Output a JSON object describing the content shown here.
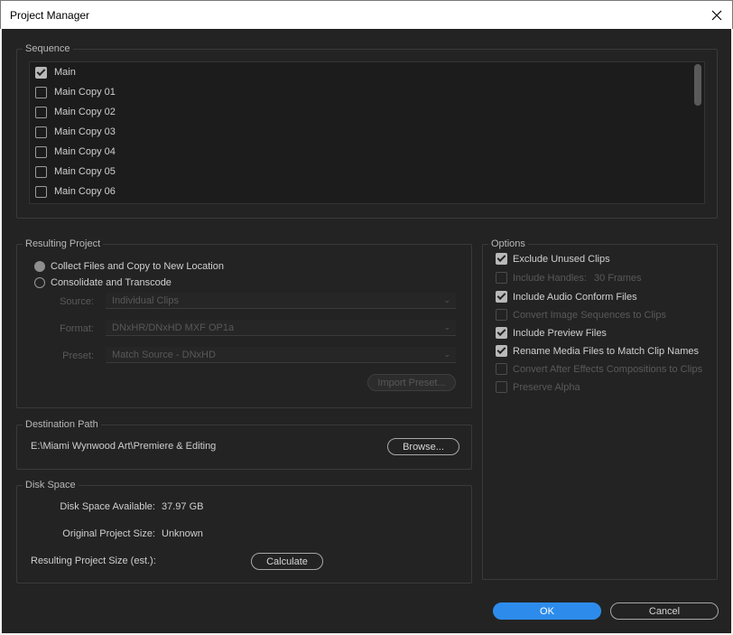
{
  "window": {
    "title": "Project Manager"
  },
  "sequence": {
    "legend": "Sequence",
    "items": [
      {
        "label": "Main",
        "checked": true
      },
      {
        "label": "Main Copy 01",
        "checked": false
      },
      {
        "label": "Main Copy 02",
        "checked": false
      },
      {
        "label": "Main Copy 03",
        "checked": false
      },
      {
        "label": "Main Copy 04",
        "checked": false
      },
      {
        "label": "Main Copy 05",
        "checked": false
      },
      {
        "label": "Main Copy 06",
        "checked": false
      }
    ]
  },
  "resulting_project": {
    "legend": "Resulting Project",
    "options": [
      {
        "label": "Collect Files and Copy to New Location",
        "selected": true
      },
      {
        "label": "Consolidate and Transcode",
        "selected": false
      }
    ],
    "source_label": "Source:",
    "source_value": "Individual Clips",
    "format_label": "Format:",
    "format_value": "DNxHR/DNxHD MXF OP1a",
    "preset_label": "Preset:",
    "preset_value": "Match Source - DNxHD",
    "import_preset": "Import Preset..."
  },
  "options": {
    "legend": "Options",
    "exclude_unused": "Exclude Unused Clips",
    "include_handles": "Include Handles:",
    "handles_value": "30 Frames",
    "audio_conform": "Include Audio Conform Files",
    "convert_image_seq": "Convert Image Sequences to Clips",
    "preview_files": "Include Preview Files",
    "rename_media": "Rename Media Files to Match Clip Names",
    "convert_ae": "Convert After Effects Compositions to Clips",
    "preserve_alpha": "Preserve Alpha"
  },
  "destination": {
    "legend": "Destination Path",
    "path": "E:\\Miami Wynwood Art\\Premiere & Editing",
    "browse": "Browse..."
  },
  "disk_space": {
    "legend": "Disk Space",
    "available_label": "Disk Space Available:",
    "available_value": "37.97 GB",
    "original_label": "Original Project Size:",
    "original_value": "Unknown",
    "resulting_label": "Resulting Project Size (est.):",
    "calculate": "Calculate"
  },
  "footer": {
    "ok": "OK",
    "cancel": "Cancel"
  }
}
